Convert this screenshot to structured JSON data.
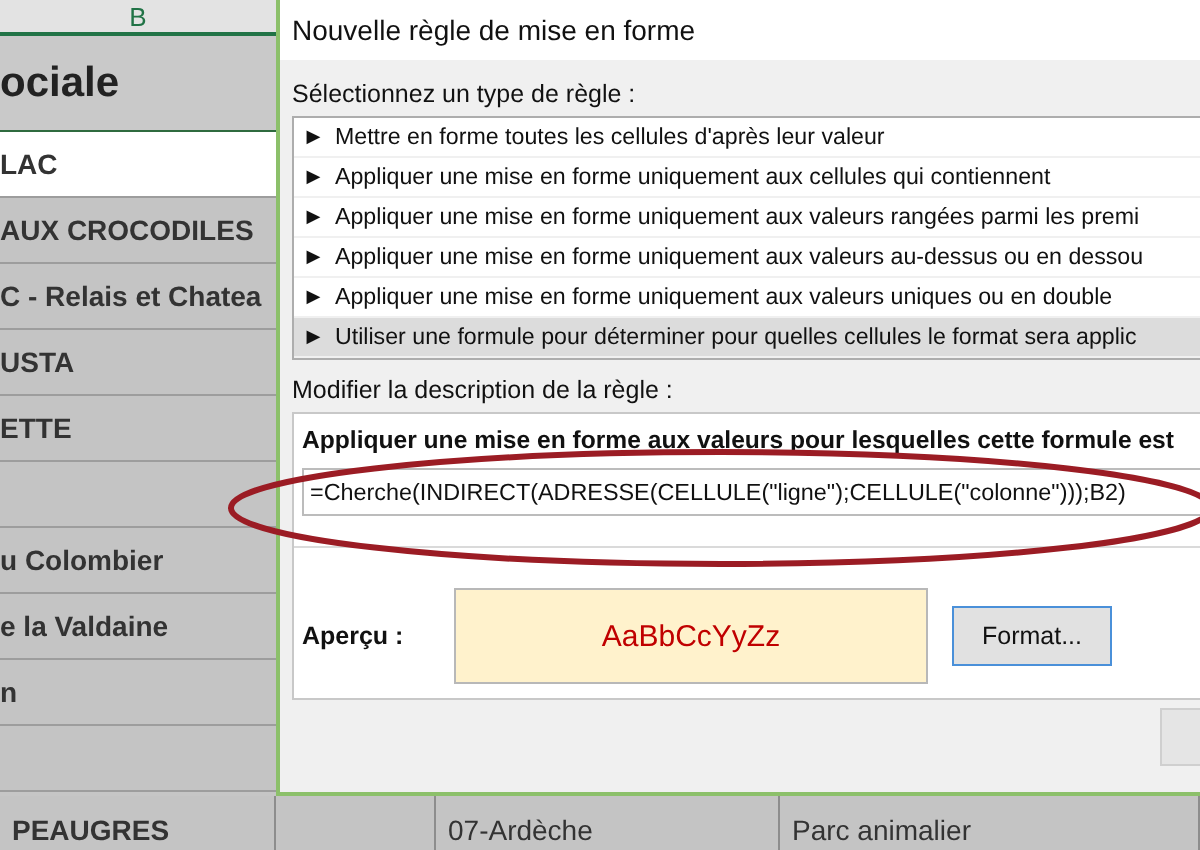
{
  "sheet": {
    "column_header": "B",
    "header_cell": "ociale",
    "rows": [
      {
        "text": "LAC",
        "selected": true
      },
      {
        "text": "AUX CROCODILES",
        "selected": false
      },
      {
        "text": "C - Relais et Chatea",
        "selected": false
      },
      {
        "text": "USTA",
        "selected": false
      },
      {
        "text": "ETTE",
        "selected": false
      },
      {
        "text": "",
        "selected": false
      },
      {
        "text": "u Colombier",
        "selected": false
      },
      {
        "text": "e la Valdaine",
        "selected": false
      },
      {
        "text": "n",
        "selected": false
      },
      {
        "text": "",
        "selected": false
      }
    ],
    "bottom_row": [
      "PEAUGRES",
      "07-Ardèche",
      "Parc animalier"
    ]
  },
  "dialog": {
    "title": "Nouvelle règle de mise en forme",
    "rule_type_label": "Sélectionnez un type de règle :",
    "rule_types": [
      {
        "label": "Mettre en forme toutes les cellules d'après leur valeur",
        "selected": false
      },
      {
        "label": "Appliquer une mise en forme uniquement aux cellules qui contiennent",
        "selected": false
      },
      {
        "label": "Appliquer une mise en forme uniquement aux valeurs rangées parmi les premi",
        "selected": false
      },
      {
        "label": "Appliquer une mise en forme uniquement aux valeurs au-dessus ou en dessou",
        "selected": false
      },
      {
        "label": "Appliquer une mise en forme uniquement aux valeurs uniques ou en double",
        "selected": false
      },
      {
        "label": "Utiliser une formule pour déterminer pour quelles cellules le format sera applic",
        "selected": true
      }
    ],
    "bullet": "►",
    "description_label": "Modifier la description de la règle :",
    "formula_label": "Appliquer une mise en forme aux valeurs pour lesquelles cette formule est",
    "formula_value": "=Cherche(INDIRECT(ADRESSE(CELLULE(\"ligne\");CELLULE(\"colonne\")));B2)",
    "preview_label": "Aperçu :",
    "preview_sample": "AaBbCcYyZz",
    "format_button": "Format..."
  }
}
